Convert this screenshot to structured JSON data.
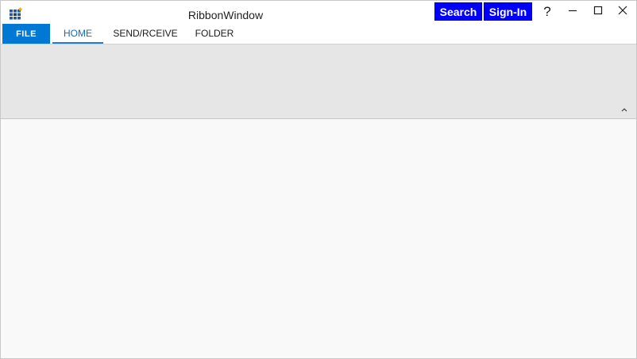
{
  "window": {
    "title": "RibbonWindow"
  },
  "title_buttons": {
    "search_label": "Search",
    "signin_label": "Sign-In",
    "help_label": "?"
  },
  "ribbon": {
    "file_tab": "FILE",
    "tabs": [
      {
        "label": "HOME",
        "selected": true
      },
      {
        "label": "SEND/RCEIVE",
        "selected": false
      },
      {
        "label": "FOLDER",
        "selected": false
      }
    ]
  },
  "colors": {
    "accent": "#0078d4",
    "title_button_bg": "#0000ff",
    "ribbon_bg": "#e6e6e6",
    "content_bg": "#f9f9f9"
  },
  "icons": {
    "app": "app-grid-icon",
    "minimize": "minimize-icon",
    "maximize": "maximize-icon",
    "close": "close-icon",
    "collapse": "chevron-up-icon"
  }
}
